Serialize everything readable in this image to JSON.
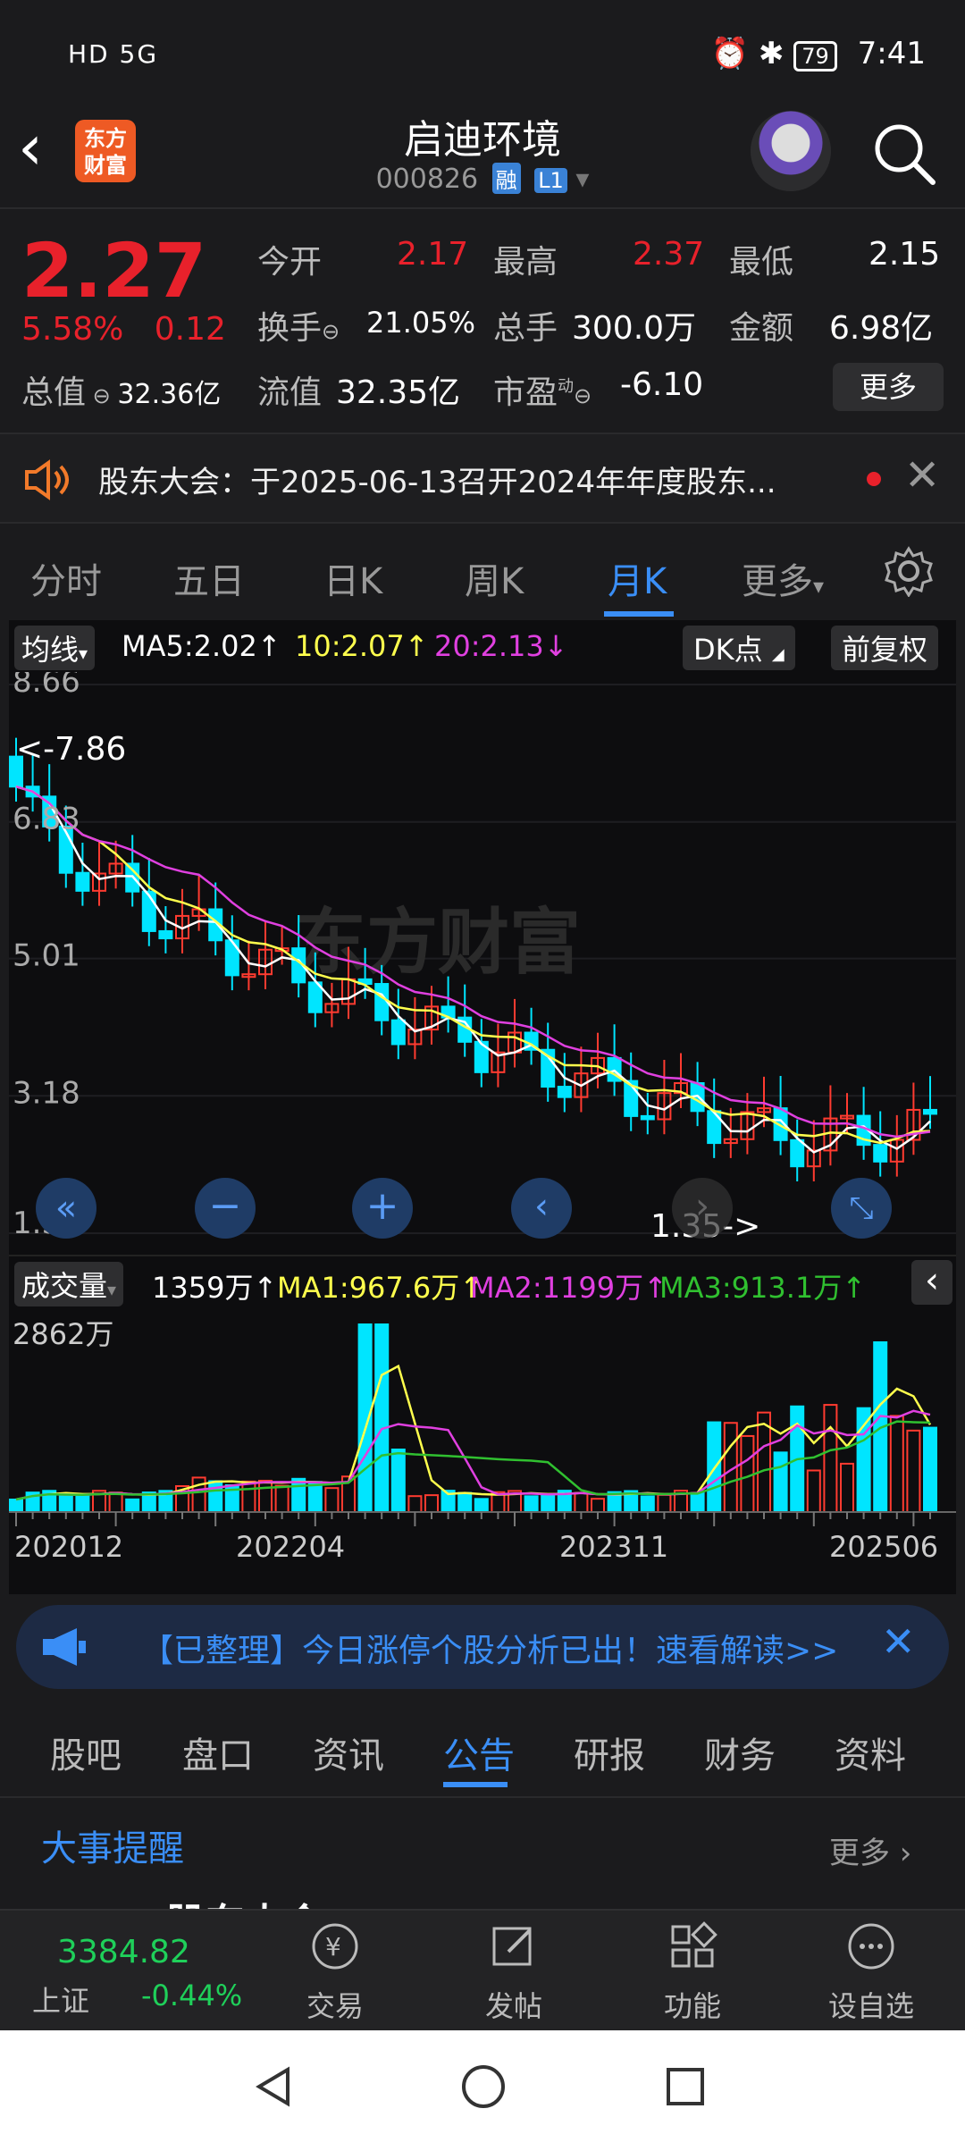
{
  "status_bar": {
    "left": "HD 5G",
    "battery": "79",
    "time": "7:41"
  },
  "header": {
    "title": "启迪环境",
    "code": "000826",
    "tag1": "融",
    "tag2": "L1",
    "logo_line1": "东方",
    "logo_line2": "财富"
  },
  "quote": {
    "price": "2.27",
    "change_pct": "5.58%",
    "change": "0.12",
    "open_label": "今开",
    "open": "2.17",
    "high_label": "最高",
    "high": "2.37",
    "low_label": "最低",
    "low": "2.15",
    "turnover_label": "换手",
    "turnover": "21.05%",
    "volume_label": "总手",
    "volume": "300.0万",
    "amount_label": "金额",
    "amount": "6.98亿",
    "mktcap_label": "总值",
    "mktcap": "32.36亿",
    "float_label": "流值",
    "float": "32.35亿",
    "pe_label": "市盈",
    "pe_sup": "动",
    "pe": "-6.10",
    "more": "更多"
  },
  "notice": {
    "text": "股东大会：于2025-06-13召开2024年年度股东..."
  },
  "ktabs": [
    "分时",
    "五日",
    "日K",
    "周K",
    "月K",
    "更多"
  ],
  "ma_bar": {
    "label": "均线",
    "ma5": "MA5:2.02",
    "ma10": "10:2.07",
    "ma20": "20:2.13",
    "dk": "DK点",
    "fq": "前复权",
    "colors": {
      "ma5": "#ffffff",
      "ma10": "#ffff4d",
      "ma20": "#e040e0"
    }
  },
  "chart_data": {
    "type": "candlestick",
    "y_ticks": [
      "8.66",
      "6.83",
      "5.01",
      "3.18",
      "1.35"
    ],
    "ylim": [
      1.35,
      8.66
    ],
    "high_marker": "<-7.86",
    "low_marker": "1.35->",
    "watermark": "东方财富",
    "x_ticks": [
      "202012",
      "202204",
      "202311",
      "202506"
    ]
  },
  "volume": {
    "label": "成交量",
    "current": "1359万",
    "ma1": "MA1:967.6万",
    "ma2": "MA2:1199万",
    "ma3": "MA3:913.1万",
    "max_label": "2862万",
    "colors": {
      "ma1": "#ffff4d",
      "ma2": "#e040e0",
      "ma3": "#30c030"
    }
  },
  "ad": {
    "text": "【已整理】今日涨停个股分析已出！速看解读>>"
  },
  "btabs": [
    "股吧",
    "盘口",
    "资讯",
    "公告",
    "研报",
    "财务",
    "资料"
  ],
  "events": {
    "title": "大事提醒",
    "more": "更多",
    "partial": "股东大会"
  },
  "bottom_nav": {
    "index_value": "3384.82",
    "index_name": "上证",
    "index_change": "-0.44%",
    "items": [
      "交易",
      "发帖",
      "功能",
      "设自选"
    ]
  }
}
